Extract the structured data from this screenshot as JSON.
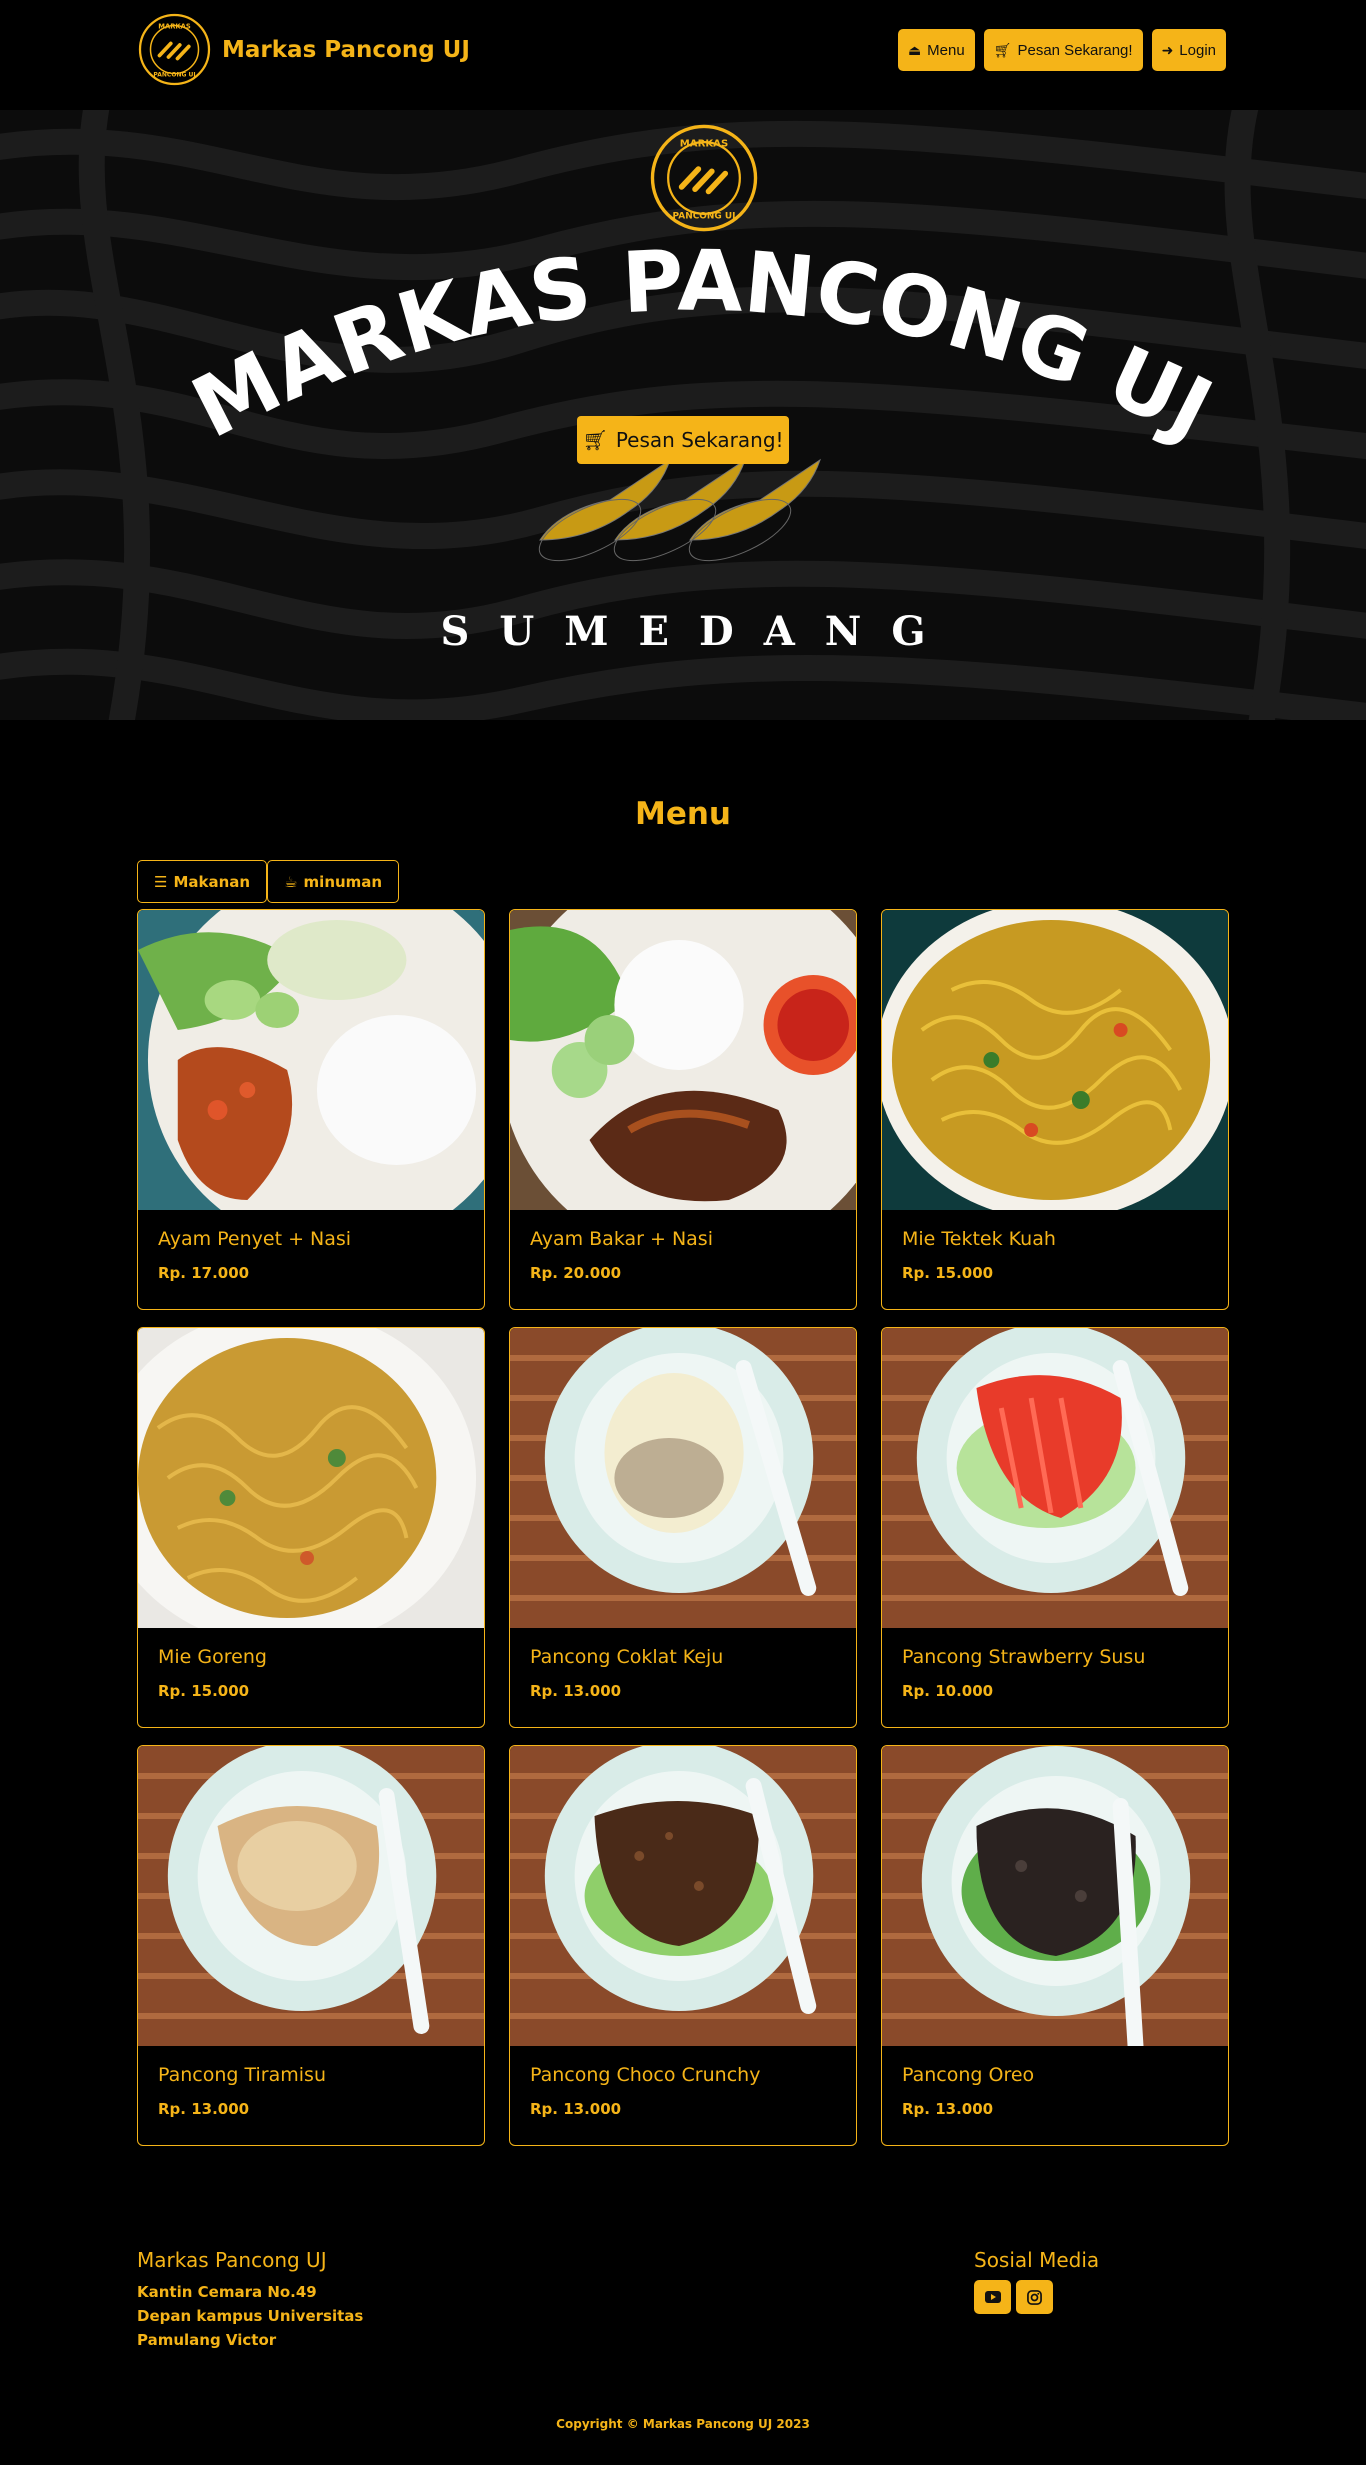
{
  "navbar": {
    "brand": "Markas Pancong UJ",
    "buttons": [
      {
        "label": "Menu",
        "icon": "bowl-icon"
      },
      {
        "label": "Pesan Sekarang!",
        "icon": "cart-icon"
      },
      {
        "label": "Login",
        "icon": "login-icon"
      }
    ]
  },
  "logo_text": {
    "top": "MARKAS",
    "bottom": "PANCONG UJ"
  },
  "hero": {
    "title": "MARKAS PANCONG UJ",
    "cta": "Pesan Sekarang!",
    "subtitle": "SUMEDANG"
  },
  "menu": {
    "heading": "Menu",
    "filters": [
      {
        "label": "Makanan",
        "icon": "burger-icon"
      },
      {
        "label": "minuman",
        "icon": "cup-icon"
      }
    ],
    "items": [
      {
        "name": "Ayam Penyet + Nasi",
        "price": "Rp. 17.000"
      },
      {
        "name": "Ayam Bakar + Nasi",
        "price": "Rp. 20.000"
      },
      {
        "name": "Mie Tektek Kuah",
        "price": "Rp. 15.000"
      },
      {
        "name": "Mie Goreng",
        "price": "Rp. 15.000"
      },
      {
        "name": "Pancong Coklat Keju",
        "price": "Rp. 13.000"
      },
      {
        "name": "Pancong Strawberry Susu",
        "price": "Rp. 10.000"
      },
      {
        "name": "Pancong Tiramisu",
        "price": "Rp. 13.000"
      },
      {
        "name": "Pancong Choco Crunchy",
        "price": "Rp. 13.000"
      },
      {
        "name": "Pancong Oreo",
        "price": "Rp. 13.000"
      }
    ]
  },
  "footer": {
    "title": "Markas Pancong UJ",
    "address_lines": [
      "Kantin Cemara No.49",
      "Depan kampus Universitas",
      "Pamulang Victor"
    ],
    "social_title": "Sosial Media",
    "social": [
      {
        "icon": "youtube-icon"
      },
      {
        "icon": "instagram-icon"
      }
    ],
    "copyright": "Copyright © Markas Pancong UJ 2023"
  },
  "colors": {
    "accent": "#f5b418",
    "background": "#000000",
    "hero_bg": "#0c0c0c"
  }
}
